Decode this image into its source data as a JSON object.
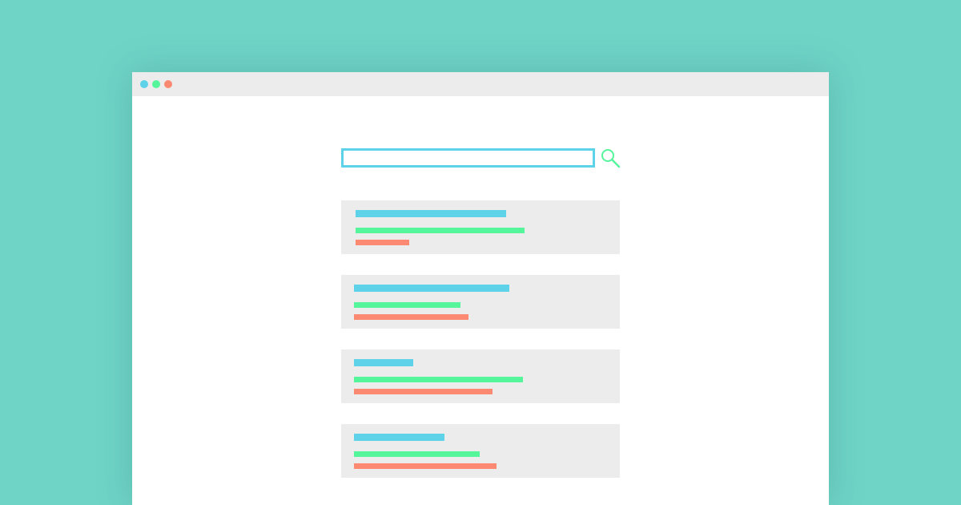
{
  "window": {
    "controls": [
      {
        "name": "window-control-dot",
        "color": "#5ed2e8"
      },
      {
        "name": "window-control-dot",
        "color": "#55f59c"
      },
      {
        "name": "window-control-dot",
        "color": "#fc8a72"
      }
    ]
  },
  "search": {
    "value": "",
    "placeholder": "",
    "border_color": "#5ed2e8",
    "icon": "search-icon",
    "icon_color": "#55f59c"
  },
  "results": [
    {
      "title_color": "#5ed2e8",
      "url_color": "#55f59c",
      "snippet_color": "#fc8a72"
    },
    {
      "title_color": "#5ed2e8",
      "url_color": "#55f59c",
      "snippet_color": "#fc8a72"
    },
    {
      "title_color": "#5ed2e8",
      "url_color": "#55f59c",
      "snippet_color": "#fc8a72"
    },
    {
      "title_color": "#5ed2e8",
      "url_color": "#55f59c",
      "snippet_color": "#fc8a72"
    }
  ],
  "colors": {
    "background": "#6fd3c6",
    "window": "#ffffff",
    "titlebar": "#ececec",
    "card": "#ececec",
    "accent_blue": "#5ed2e8",
    "accent_green": "#55f59c",
    "accent_red": "#fc8a72"
  }
}
